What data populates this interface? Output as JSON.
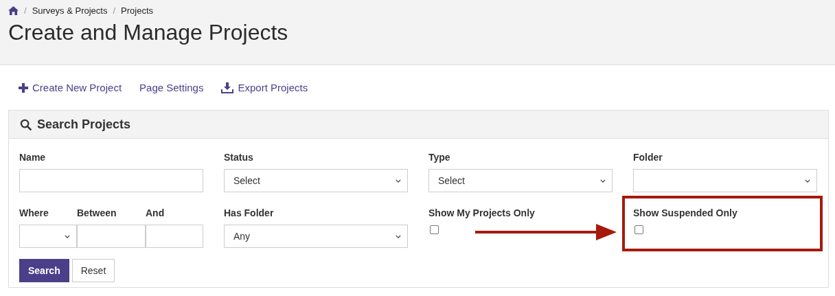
{
  "breadcrumb": [
    {
      "kind": "home"
    },
    {
      "kind": "separator",
      "label": "/"
    },
    {
      "kind": "link",
      "label": "Surveys & Projects"
    },
    {
      "kind": "separator",
      "label": "/"
    },
    {
      "kind": "link",
      "label": "Projects"
    }
  ],
  "title": "Create and Manage Projects",
  "actions": [
    {
      "label": "Create New Project",
      "kind": "create"
    },
    {
      "label": "Page Settings",
      "kind": "settings"
    },
    {
      "label": "Export Projects",
      "kind": "export"
    }
  ],
  "search_panel": {
    "title": "Search Projects",
    "rows": [
      [
        {
          "kind": "text",
          "label": "Name"
        },
        {
          "kind": "select",
          "label": "Status",
          "value": "Select"
        },
        {
          "kind": "select",
          "label": "Type",
          "value": "Select"
        },
        {
          "kind": "select",
          "label": "Folder"
        }
      ],
      [
        {
          "kind": "range",
          "parts": [
            {
              "kind": "select",
              "label": "Where"
            },
            {
              "kind": "text",
              "label": "Between"
            },
            {
              "kind": "text",
              "label": "And"
            }
          ]
        },
        {
          "kind": "select",
          "label": "Has Folder",
          "value": "Any"
        },
        {
          "kind": "checkbox",
          "label": "Show My Projects Only",
          "checked": false,
          "highlighted": false
        },
        {
          "kind": "checkbox",
          "label": "Show Suspended Only",
          "checked": false,
          "highlighted": true
        }
      ]
    ],
    "buttons": [
      {
        "label": "Search",
        "primary": true
      },
      {
        "label": "Reset",
        "primary": false
      }
    ]
  }
}
